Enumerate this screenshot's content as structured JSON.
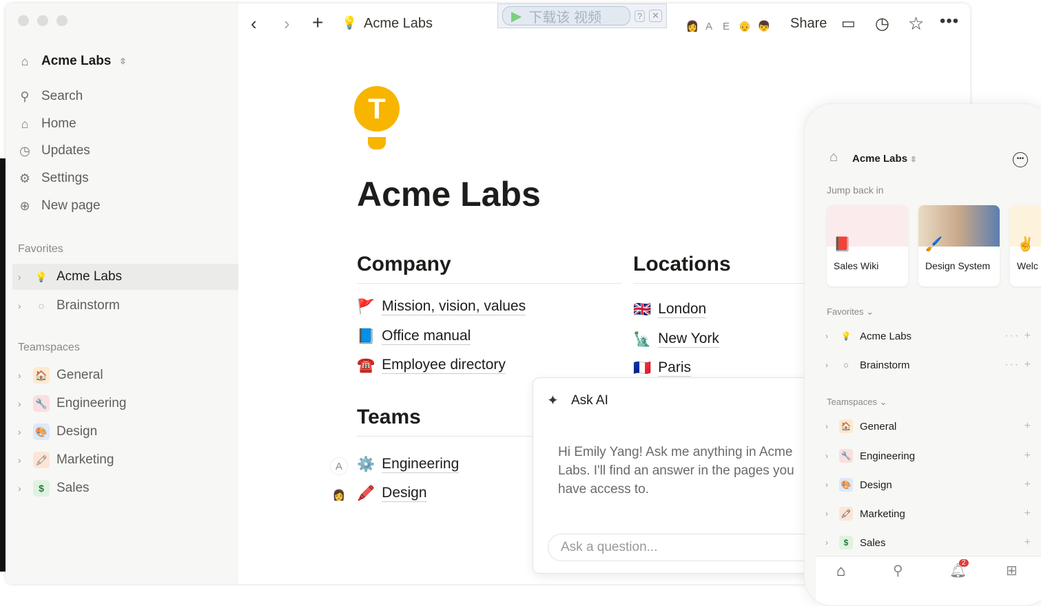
{
  "window": {
    "traffic_lights": [
      "close",
      "minimize",
      "zoom"
    ]
  },
  "sidebar": {
    "workspace": "Acme Labs",
    "nav": [
      {
        "label": "Search",
        "icon": "search-icon"
      },
      {
        "label": "Home",
        "icon": "home-icon"
      },
      {
        "label": "Updates",
        "icon": "clock-icon"
      },
      {
        "label": "Settings",
        "icon": "gear-icon"
      },
      {
        "label": "New page",
        "icon": "plus-circle-icon"
      }
    ],
    "favorites_label": "Favorites",
    "favorites": [
      {
        "label": "Acme Labs",
        "emoji": "💡",
        "selected": true
      },
      {
        "label": "Brainstorm",
        "emoji": "◌"
      }
    ],
    "teamspaces_label": "Teamspaces",
    "teamspaces": [
      {
        "label": "General",
        "emoji": "🏠",
        "bg": "#fde9cf"
      },
      {
        "label": "Engineering",
        "emoji": "🔧",
        "bg": "#fcdede"
      },
      {
        "label": "Design",
        "emoji": "🎨",
        "bg": "#dbe9fb"
      },
      {
        "label": "Marketing",
        "emoji": "🖍",
        "bg": "#fde5d6"
      },
      {
        "label": "Sales",
        "emoji": "$",
        "bg": "#dff2e1"
      }
    ]
  },
  "topbar": {
    "breadcrumb": "Acme Labs",
    "share": "Share",
    "overlay_text": "下载该 视频",
    "overlay_help": "?",
    "overlay_close": "✕",
    "avatars": [
      "A",
      "E"
    ]
  },
  "page": {
    "title": "Acme Labs",
    "company": {
      "heading": "Company",
      "links": [
        {
          "emoji": "🚩",
          "label": "Mission, vision, values"
        },
        {
          "emoji": "📘",
          "label": "Office manual"
        },
        {
          "emoji": "☎️",
          "label": "Employee directory"
        }
      ]
    },
    "locations": {
      "heading": "Locations",
      "links": [
        {
          "emoji": "🇬🇧",
          "label": "London"
        },
        {
          "emoji": "🗽",
          "label": "New York"
        },
        {
          "emoji": "🇫🇷",
          "label": "Paris"
        }
      ]
    },
    "teams": {
      "heading": "Teams",
      "links": [
        {
          "emoji": "⚙️",
          "label": "Engineering",
          "avatar": "A"
        },
        {
          "emoji": "🖍️",
          "label": "Design",
          "avatar": ""
        }
      ]
    }
  },
  "ask_ai": {
    "title": "Ask AI",
    "message": "Hi Emily Yang! Ask me anything in Acme Labs. I'll find an answer in the pages you have access to.",
    "placeholder": "Ask a question..."
  },
  "mobile": {
    "workspace": "Acme Labs",
    "jump_back": "Jump back in",
    "cards": [
      {
        "label": "Sales Wiki",
        "emoji": "📕"
      },
      {
        "label": "Design System",
        "emoji": "🖌️"
      },
      {
        "label": "Welc",
        "emoji": "✌️"
      }
    ],
    "favorites_label": "Favorites",
    "favorites": [
      {
        "label": "Acme Labs",
        "emoji": "💡"
      },
      {
        "label": "Brainstorm",
        "emoji": "◌"
      }
    ],
    "teamspaces_label": "Teamspaces",
    "teamspaces": [
      {
        "label": "General",
        "emoji": "🏠",
        "bg": "#fde9cf"
      },
      {
        "label": "Engineering",
        "emoji": "🔧",
        "bg": "#fcdede"
      },
      {
        "label": "Design",
        "emoji": "🎨",
        "bg": "#dbe9fb"
      },
      {
        "label": "Marketing",
        "emoji": "🖍",
        "bg": "#fde5d6"
      },
      {
        "label": "Sales",
        "emoji": "$",
        "bg": "#dff2e1"
      }
    ],
    "notification_count": "2"
  }
}
